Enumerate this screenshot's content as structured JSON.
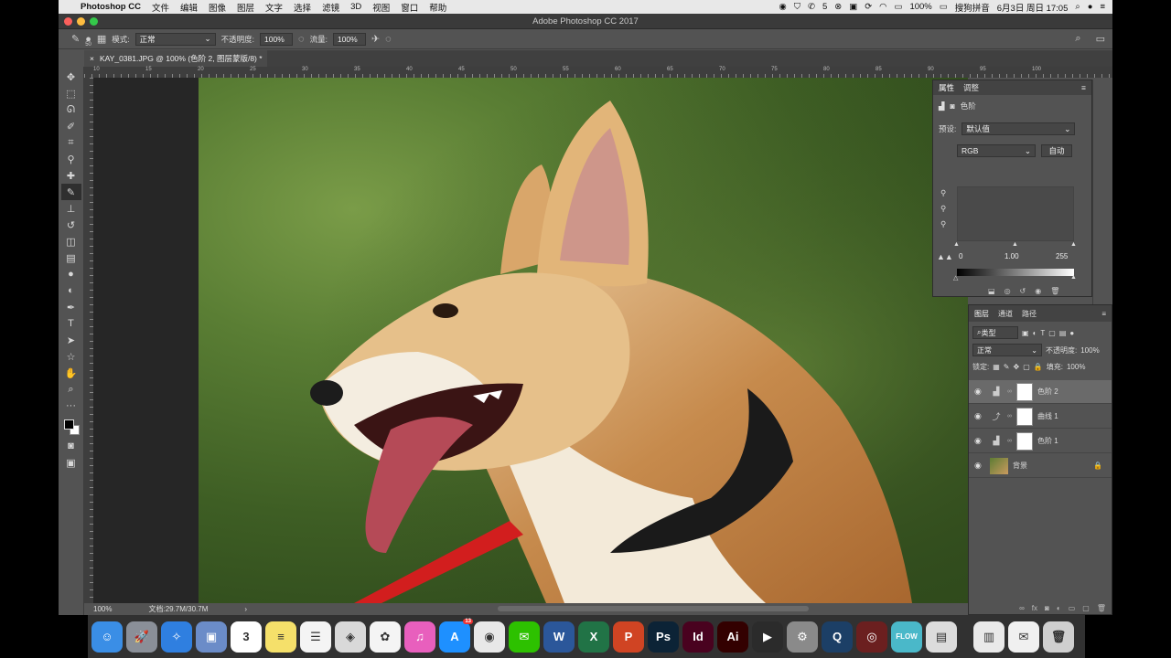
{
  "menubar": {
    "app_name": "Photoshop CC",
    "items": [
      "文件",
      "编辑",
      "图像",
      "图层",
      "文字",
      "选择",
      "滤镜",
      "3D",
      "视图",
      "窗口",
      "帮助"
    ],
    "battery": "100%",
    "input_method": "搜狗拼音",
    "datetime": "6月3日 周日 17:05",
    "wechat_badge": "5"
  },
  "window": {
    "title": "Adobe Photoshop CC 2017"
  },
  "options_bar": {
    "brush_size": "50",
    "mode_label": "模式:",
    "mode_value": "正常",
    "opacity_label": "不透明度:",
    "opacity_value": "100%",
    "flow_label": "流量:",
    "flow_value": "100%"
  },
  "document_tab": {
    "title": "KAY_0381.JPG @ 100% (色阶 2, 图层蒙版/8) *"
  },
  "ruler_labels": [
    "10",
    "15",
    "20",
    "25",
    "30",
    "35",
    "40",
    "45",
    "50",
    "55",
    "60",
    "65",
    "70",
    "75",
    "80",
    "85",
    "90",
    "95",
    "100"
  ],
  "status_bar": {
    "zoom": "100%",
    "doc_size": "文档:29.7M/30.7M"
  },
  "properties_panel": {
    "tabs": [
      "属性",
      "调整"
    ],
    "adjustment_name": "色阶",
    "preset_label": "预设:",
    "preset_value": "默认值",
    "channel_value": "RGB",
    "auto_label": "自动",
    "input_black": "0",
    "input_gamma": "1.00",
    "input_white": "255"
  },
  "layers_panel": {
    "tabs": [
      "图层",
      "通道",
      "路径"
    ],
    "filter_label": "类型",
    "blend_mode": "正常",
    "opacity_label": "不透明度:",
    "opacity_value": "100%",
    "lock_label": "锁定:",
    "fill_label": "填充:",
    "fill_value": "100%",
    "layers": [
      {
        "name": "色阶 2",
        "type": "levels",
        "selected": true
      },
      {
        "name": "曲线 1",
        "type": "curves",
        "selected": false
      },
      {
        "name": "色阶 1",
        "type": "levels",
        "selected": false
      },
      {
        "name": "背景",
        "type": "background",
        "selected": false
      }
    ]
  },
  "dock": {
    "calendar_day": "3",
    "appstore_badge": "13",
    "apps": [
      {
        "name": "Finder",
        "color": "#3a8ee6",
        "glyph": "☺"
      },
      {
        "name": "Launchpad",
        "color": "#8a8f98",
        "glyph": "🚀"
      },
      {
        "name": "Safari",
        "color": "#2f7fe0",
        "glyph": "✧"
      },
      {
        "name": "Preview",
        "color": "#6b8cc8",
        "glyph": "▣"
      },
      {
        "name": "Calendar",
        "color": "#ffffff",
        "glyph": "3"
      },
      {
        "name": "Notes",
        "color": "#f5e06a",
        "glyph": "≡"
      },
      {
        "name": "Reminders",
        "color": "#f4f4f4",
        "glyph": "☰"
      },
      {
        "name": "Photo Booth",
        "color": "#d9d9d9",
        "glyph": "◈"
      },
      {
        "name": "Photos",
        "color": "#f4f4f4",
        "glyph": "✿"
      },
      {
        "name": "iTunes",
        "color": "#e85fbd",
        "glyph": "♫"
      },
      {
        "name": "App Store",
        "color": "#1e90ff",
        "glyph": "A"
      },
      {
        "name": "Chrome",
        "color": "#e8e8e8",
        "glyph": "◉"
      },
      {
        "name": "WeChat",
        "color": "#2dc100",
        "glyph": "✉"
      },
      {
        "name": "Word",
        "color": "#2b579a",
        "glyph": "W"
      },
      {
        "name": "Excel",
        "color": "#217346",
        "glyph": "X"
      },
      {
        "name": "PowerPoint",
        "color": "#d04423",
        "glyph": "P"
      },
      {
        "name": "Photoshop",
        "color": "#0c2336",
        "glyph": "Ps"
      },
      {
        "name": "InDesign",
        "color": "#49021f",
        "glyph": "Id"
      },
      {
        "name": "Illustrator",
        "color": "#330000",
        "glyph": "Ai"
      },
      {
        "name": "Final Cut Pro",
        "color": "#2b2b2b",
        "glyph": "▶"
      },
      {
        "name": "System Preferences",
        "color": "#8a8a8a",
        "glyph": "⚙"
      },
      {
        "name": "QuickTime",
        "color": "#1c3f66",
        "glyph": "Q"
      },
      {
        "name": "Photo Booth 2",
        "color": "#6b1f1f",
        "glyph": "◎"
      },
      {
        "name": "Flow VPN",
        "color": "#4ab8c9",
        "glyph": "FLOW"
      },
      {
        "name": "Document",
        "color": "#dcdcdc",
        "glyph": "▤"
      },
      {
        "name": "Folder",
        "color": "#e9e9e9",
        "glyph": "▥"
      },
      {
        "name": "Mail",
        "color": "#f0f0f0",
        "glyph": "✉"
      },
      {
        "name": "Trash",
        "color": "#cfcfcf",
        "glyph": "🗑"
      }
    ]
  },
  "colors": {
    "ps_panel": "#535353",
    "ps_dark": "#3a3a3a",
    "accent_selected_layer": "#6a6a6a"
  }
}
